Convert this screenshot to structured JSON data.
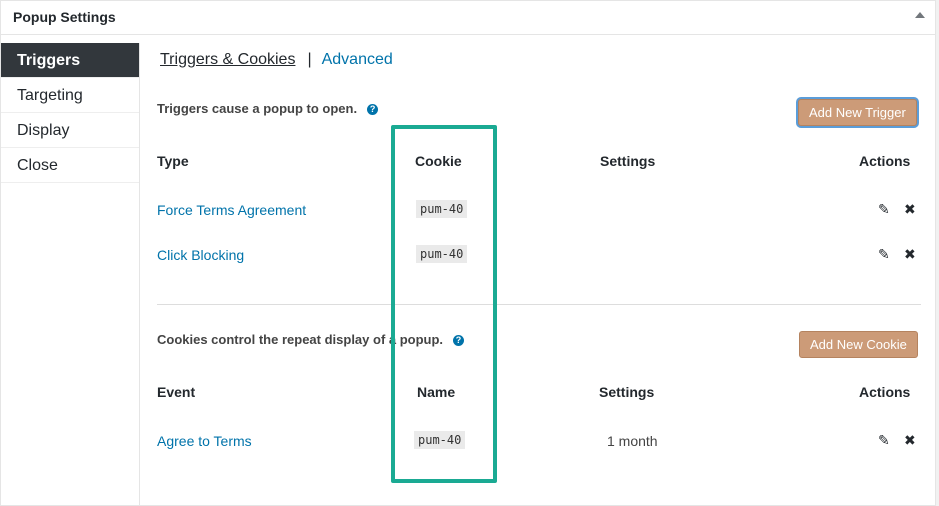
{
  "panel": {
    "title": "Popup Settings"
  },
  "sidebar": {
    "items": [
      {
        "label": "Triggers"
      },
      {
        "label": "Targeting"
      },
      {
        "label": "Display"
      },
      {
        "label": "Close"
      }
    ]
  },
  "tabs": {
    "active": "Triggers & Cookies",
    "separator": "|",
    "other": "Advanced"
  },
  "triggers": {
    "description": "Triggers cause a popup to open.",
    "help_icon": "?",
    "add_button": "Add New Trigger",
    "headers": {
      "type": "Type",
      "cookie": "Cookie",
      "settings": "Settings",
      "actions": "Actions"
    },
    "rows": [
      {
        "type": "Force Terms Agreement",
        "cookie": "pum-40",
        "settings": ""
      },
      {
        "type": "Click Blocking",
        "cookie": "pum-40",
        "settings": ""
      }
    ]
  },
  "cookies": {
    "description": "Cookies control the repeat display of a popup.",
    "help_icon": "?",
    "add_button": "Add New Cookie",
    "headers": {
      "event": "Event",
      "name": "Name",
      "settings": "Settings",
      "actions": "Actions"
    },
    "rows": [
      {
        "event": "Agree to Terms",
        "name": "pum-40",
        "settings": "1 month"
      }
    ]
  },
  "icons": {
    "edit": "✎",
    "delete": "✖",
    "collapse": "triangle-up-icon",
    "cursor": "mouse-pointer-icon"
  },
  "colors": {
    "link": "#0073aa",
    "button": "#cc9b78",
    "highlight": "#1aaa93",
    "sidebar_active": "#32373c"
  }
}
